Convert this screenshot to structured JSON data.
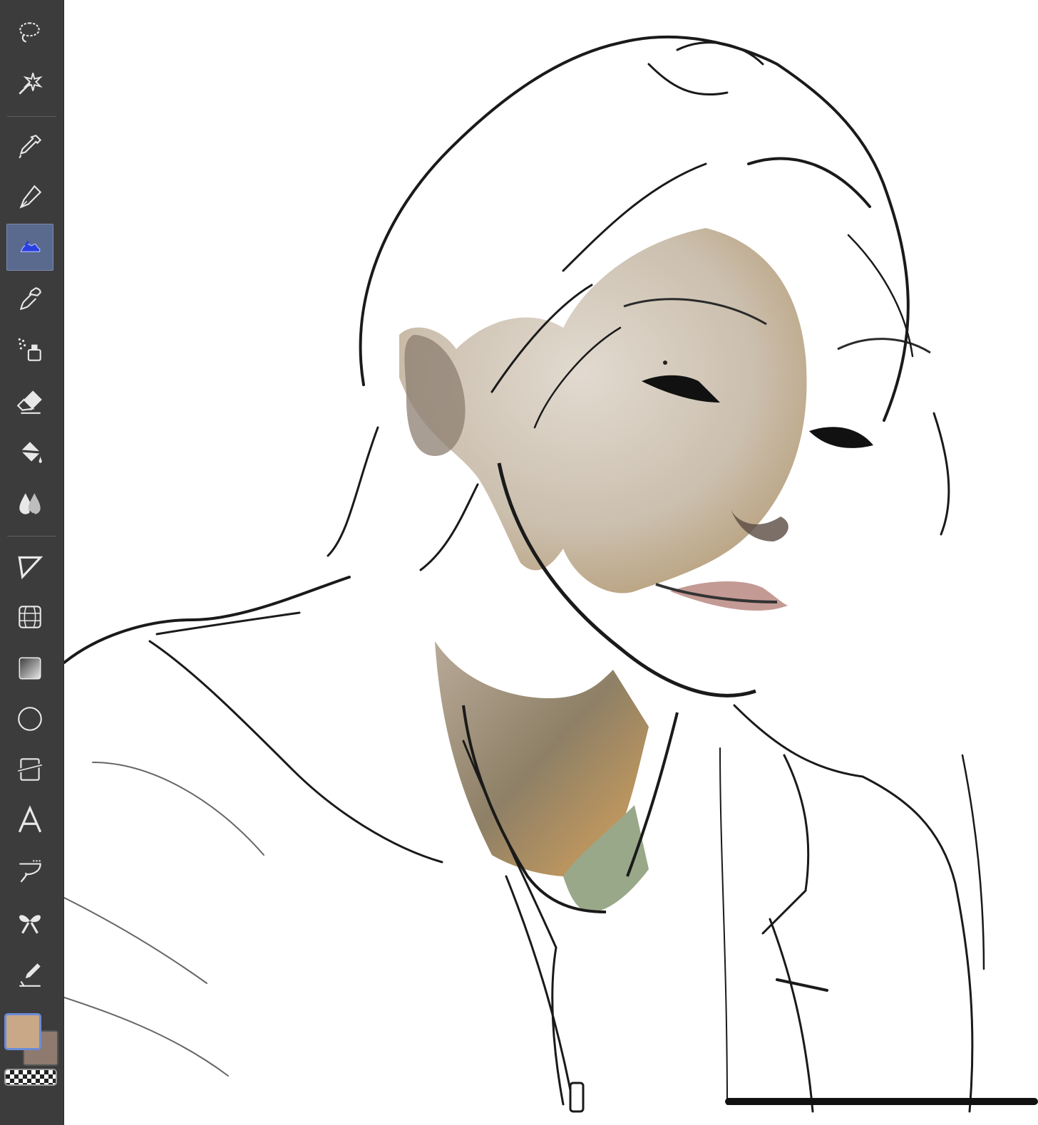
{
  "toolbar": {
    "tools": [
      {
        "name": "lasso-tool",
        "icon": "lasso-icon",
        "active": false
      },
      {
        "name": "magic-wand-tool",
        "icon": "magic-wand-icon",
        "active": false
      },
      {
        "name": "eyedropper-tool",
        "icon": "eyedropper-icon",
        "active": false
      },
      {
        "name": "pen-tool",
        "icon": "pen-nib-icon",
        "active": false
      },
      {
        "name": "brush-tool",
        "icon": "watercolor-brush-icon",
        "active": true
      },
      {
        "name": "pencil-tool",
        "icon": "pencil-icon",
        "active": false
      },
      {
        "name": "airbrush-tool",
        "icon": "airbrush-icon",
        "active": false
      },
      {
        "name": "eraser-tool",
        "icon": "eraser-icon",
        "active": false
      },
      {
        "name": "fill-tool",
        "icon": "paint-bucket-icon",
        "active": false
      },
      {
        "name": "blend-tool",
        "icon": "blend-drops-icon",
        "active": false
      },
      {
        "name": "operation-tool",
        "icon": "object-select-icon",
        "active": false
      },
      {
        "name": "perspective-ruler-tool",
        "icon": "grid-ruler-icon",
        "active": false
      },
      {
        "name": "gradient-tool",
        "icon": "gradient-icon",
        "active": false
      },
      {
        "name": "shape-tool",
        "icon": "ellipse-icon",
        "active": false
      },
      {
        "name": "frame-border-tool",
        "icon": "frame-border-icon",
        "active": false
      },
      {
        "name": "text-tool",
        "icon": "text-icon",
        "label": "A",
        "active": false
      },
      {
        "name": "balloon-tool",
        "icon": "speech-balloon-icon",
        "active": false
      },
      {
        "name": "decoration-tool",
        "icon": "ribbon-decoration-icon",
        "active": false
      },
      {
        "name": "correct-line-tool",
        "icon": "correct-line-icon",
        "active": false
      }
    ]
  },
  "colors": {
    "main_color": "#c8a886",
    "sub_color": "#8e7a6e",
    "toolbar_bg": "#3c3c3c",
    "active_tool_bg": "#5a6a8e",
    "accent": "#6a8cd8"
  }
}
